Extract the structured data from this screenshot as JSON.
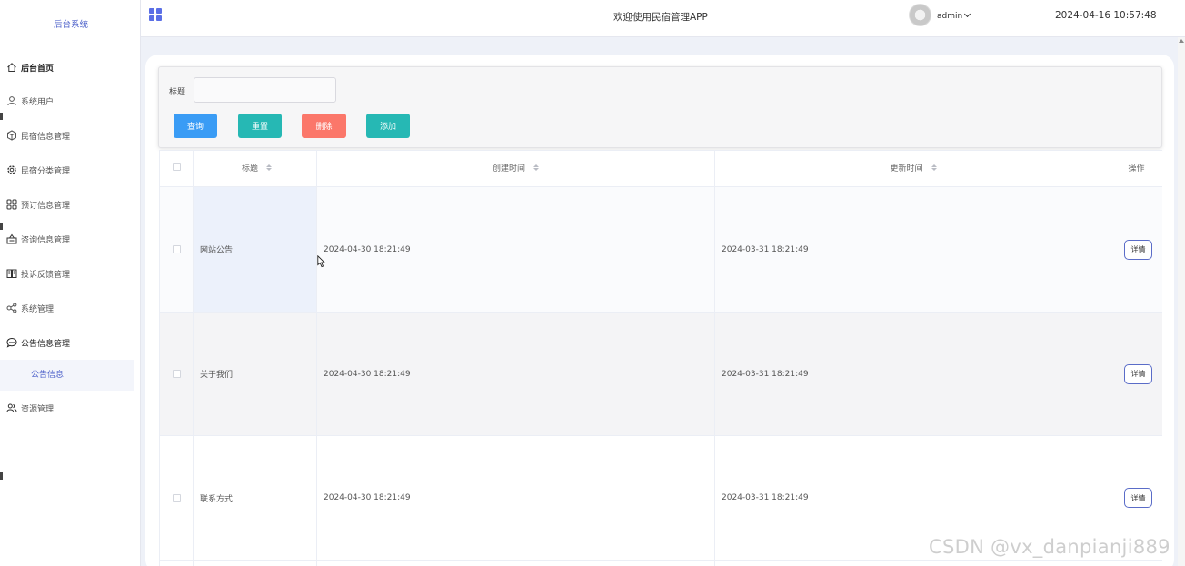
{
  "sidebar": {
    "brand": "后台系统",
    "items": [
      {
        "label": "后台首页",
        "icon": "home-icon"
      },
      {
        "label": "系统用户",
        "icon": "user-icon"
      },
      {
        "label": "民宿信息管理",
        "icon": "cube-icon"
      },
      {
        "label": "民宿分类管理",
        "icon": "gear-icon"
      },
      {
        "label": "预订信息管理",
        "icon": "grid-icon"
      },
      {
        "label": "咨询信息管理",
        "icon": "inbox-icon"
      },
      {
        "label": "投诉反馈管理",
        "icon": "book-icon"
      },
      {
        "label": "系统管理",
        "icon": "share-icon"
      },
      {
        "label": "公告信息管理",
        "icon": "chat-icon"
      },
      {
        "label": "资源管理",
        "icon": "users-icon"
      }
    ],
    "submenu": {
      "label": "公告信息"
    }
  },
  "header": {
    "welcome": "欢迎使用民宿管理APP",
    "username": "admin",
    "datetime": "2024-04-16 10:57:48"
  },
  "search": {
    "label": "标题",
    "value": "",
    "placeholder": ""
  },
  "toolbar": {
    "query_label": "查询",
    "reset_label": "重置",
    "delete_label": "删除",
    "add_label": "添加"
  },
  "table": {
    "headers": {
      "title": "标题",
      "created": "创建时间",
      "updated": "更新时间",
      "actions": "操作"
    },
    "rows": [
      {
        "title": "网站公告",
        "created": "2024-04-30 18:21:49",
        "updated": "2024-03-31 18:21:49",
        "action": "详情"
      },
      {
        "title": "关于我们",
        "created": "2024-04-30 18:21:49",
        "updated": "2024-03-31 18:21:49",
        "action": "详情"
      },
      {
        "title": "联系方式",
        "created": "2024-04-30 18:21:49",
        "updated": "2024-03-31 18:21:49",
        "action": "详情"
      }
    ]
  },
  "watermark": "CSDN @vx_danpianji889",
  "colors": {
    "primary": "#3a9cf5",
    "teal": "#26b8b4",
    "danger": "#fb776a",
    "brand": "#4b5fc9"
  }
}
